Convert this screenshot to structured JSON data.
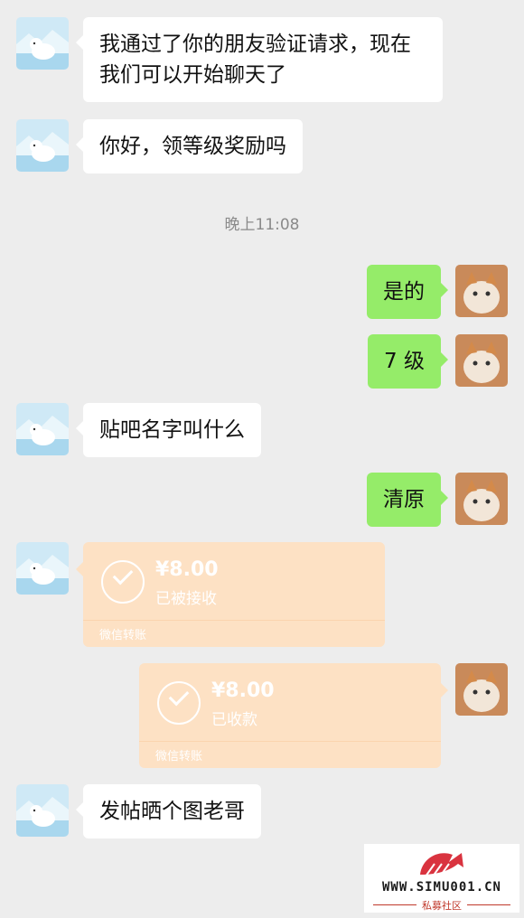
{
  "messages": [
    {
      "text": "我通过了你的朋友验证请求，现在我们可以开始聊天了"
    },
    {
      "text": "你好，领等级奖励吗"
    },
    {
      "text": "是的"
    },
    {
      "text": "7 级"
    },
    {
      "text": "贴吧名字叫什么"
    },
    {
      "text": "清原"
    },
    {
      "text": "发帖晒个图老哥"
    }
  ],
  "timestamp": "晚上11:08",
  "transfers": [
    {
      "amount": "¥8.00",
      "status": "已被接收",
      "label": "微信转账"
    },
    {
      "amount": "¥8.00",
      "status": "已收款",
      "label": "微信转账"
    }
  ],
  "watermark": {
    "site": "WWW.SIMU001.CN",
    "name": "私募社区"
  },
  "colors": {
    "background": "#ededed",
    "incoming_bubble": "#ffffff",
    "outgoing_bubble": "#95ec69",
    "transfer": "#fde1c4"
  },
  "icons": {
    "left_avatar": "polar-bear-avatar",
    "right_avatar": "cat-avatar",
    "transfer_icon": "checkmark-circle-icon"
  }
}
